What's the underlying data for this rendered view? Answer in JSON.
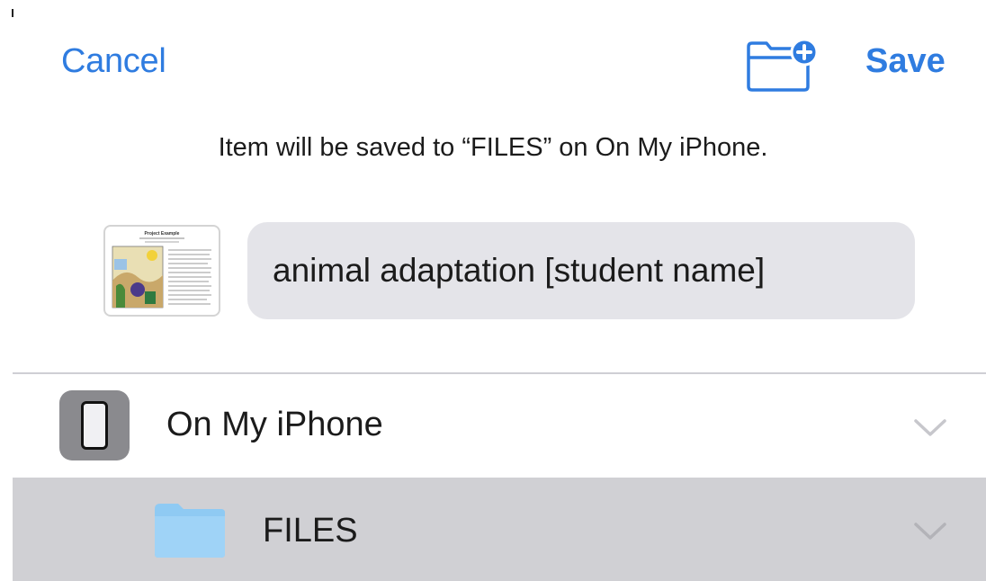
{
  "nav": {
    "cancel_label": "Cancel",
    "save_label": "Save",
    "new_folder_icon": "folder-plus-icon"
  },
  "message": "Item will be saved to “FILES” on On My iPhone.",
  "document": {
    "thumbnail_title": "Project Example",
    "filename": "animal adaptation [student name]"
  },
  "locations": [
    {
      "label": "On My iPhone",
      "icon": "iphone-icon",
      "selected": false
    },
    {
      "label": "FILES",
      "icon": "folder-icon",
      "selected": true
    }
  ],
  "colors": {
    "accent": "#2f7ce0",
    "field_bg": "#e4e4e9",
    "selected_row_bg": "#d0d0d4",
    "folder": "#8fcaf3",
    "icon_tile": "#8a8a8e"
  }
}
